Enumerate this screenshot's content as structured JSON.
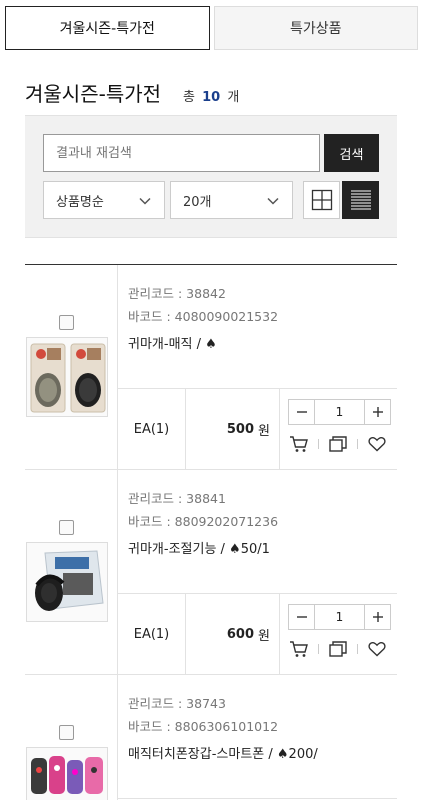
{
  "tabs": [
    {
      "label": "겨울시즌-특가전"
    },
    {
      "label": "특가상품"
    }
  ],
  "heading": {
    "title": "겨울시즌-특가전",
    "count_prefix": "총",
    "count": "10",
    "count_suffix": "개"
  },
  "search": {
    "placeholder": "결과내 재검색",
    "button": "검색",
    "sort_value": "상품명순",
    "per_page_value": "20개"
  },
  "products": [
    {
      "mgmt_code": "관리코드 : 38842",
      "barcode": "바코드 : 4080090021532",
      "name": "귀마개-매직 / ♠",
      "unit": "EA(1)",
      "price": "500",
      "currency": "원",
      "qty": "1"
    },
    {
      "mgmt_code": "관리코드 : 38841",
      "barcode": "바코드 : 8809202071236",
      "name": "귀마개-조절기능 / ♠50/1",
      "unit": "EA(1)",
      "price": "600",
      "currency": "원",
      "qty": "1"
    },
    {
      "mgmt_code": "관리코드 : 38743",
      "barcode": "바코드 : 8806306101012",
      "name": "매직터치폰장갑-스마트폰 / ♠200/",
      "unit": "",
      "price": "",
      "currency": "",
      "qty": ""
    }
  ]
}
